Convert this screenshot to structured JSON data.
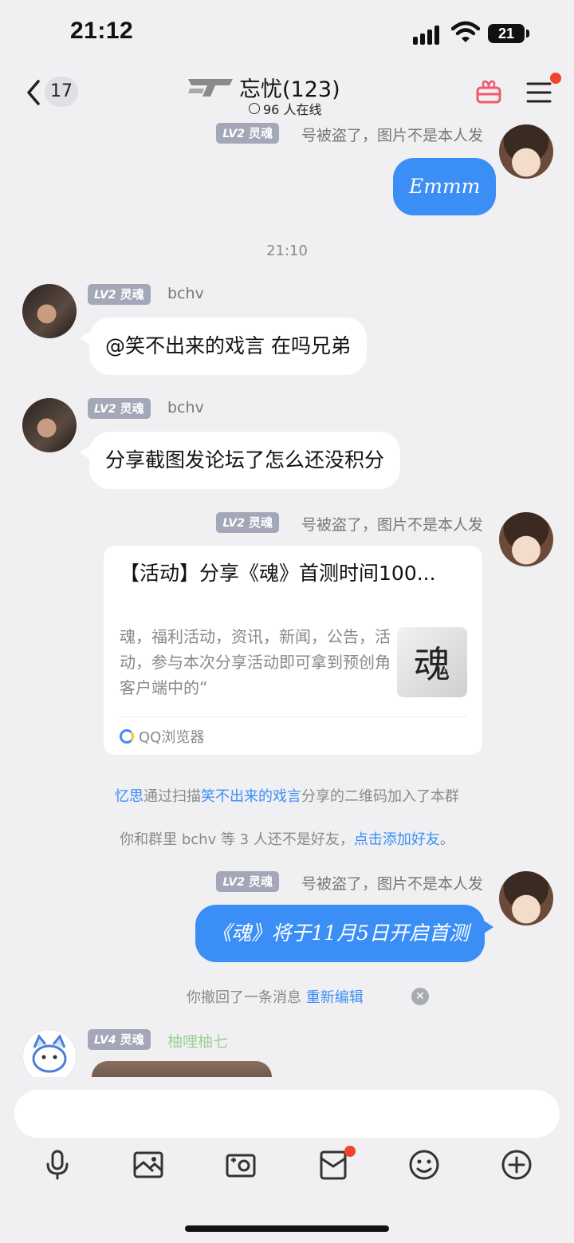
{
  "status_bar": {
    "time": "21:12",
    "battery": "21"
  },
  "header": {
    "unread_count": "17",
    "title": "忘忧(123)",
    "online_text": "96 人在线"
  },
  "chat": {
    "messages": [
      {
        "side": "right",
        "badge_level": "LV2",
        "badge_title": "灵魂",
        "nick": "号被盗了，图片不是本人发",
        "text": "Emmm"
      },
      {
        "type": "timestamp",
        "text": "21:10"
      },
      {
        "side": "left",
        "badge_level": "LV2",
        "badge_title": "灵魂",
        "nick": "bchv",
        "text": "@笑不出来的戏言 在吗兄弟"
      },
      {
        "side": "left",
        "badge_level": "LV2",
        "badge_title": "灵魂",
        "nick": "bchv",
        "text": "分享截图发论坛了怎么还没积分"
      },
      {
        "side": "right",
        "badge_level": "LV2",
        "badge_title": "灵魂",
        "nick": "号被盗了，图片不是本人发",
        "card": {
          "title": "【活动】分享《魂》首测时间100...",
          "desc": "魂，福利活动，资讯，新闻，公告，活动，参与本次分享活动即可拿到预创角客户端中的“",
          "thumb_text": "魂",
          "source": "QQ浏览器"
        }
      },
      {
        "type": "system",
        "parts": [
          {
            "text": "忆思",
            "link": true
          },
          {
            "text": "通过扫描",
            "link": false
          },
          {
            "text": "笑不出来的戏言",
            "link": true
          },
          {
            "text": "分享的二维码加入了本群",
            "link": false
          }
        ]
      },
      {
        "type": "system",
        "parts": [
          {
            "text": "你和群里 bchv 等 3 人还不是好友，",
            "link": false
          },
          {
            "text": "点击添加好友",
            "link": true
          },
          {
            "text": "。",
            "link": false
          }
        ]
      },
      {
        "side": "right",
        "badge_level": "LV2",
        "badge_title": "灵魂",
        "nick": "号被盗了，图片不是本人发",
        "text": "《魂》将于11月5日开启首测"
      },
      {
        "type": "system",
        "parts": [
          {
            "text": "你撤回了一条消息 ",
            "link": false
          },
          {
            "text": "重新编辑",
            "link": true
          }
        ]
      },
      {
        "side": "left",
        "badge_level": "LV4",
        "badge_title": "灵魂",
        "nick": "柚哩柚七"
      }
    ]
  },
  "colors": {
    "accent": "#3b8ef5",
    "badge": "#a3a7b8",
    "notify": "#f0432f"
  },
  "icons": [
    "back-icon",
    "online-icon",
    "gift-icon",
    "menu-icon",
    "mic-icon",
    "image-icon",
    "camera-icon",
    "red-packet-icon",
    "emoji-icon",
    "plus-icon"
  ]
}
